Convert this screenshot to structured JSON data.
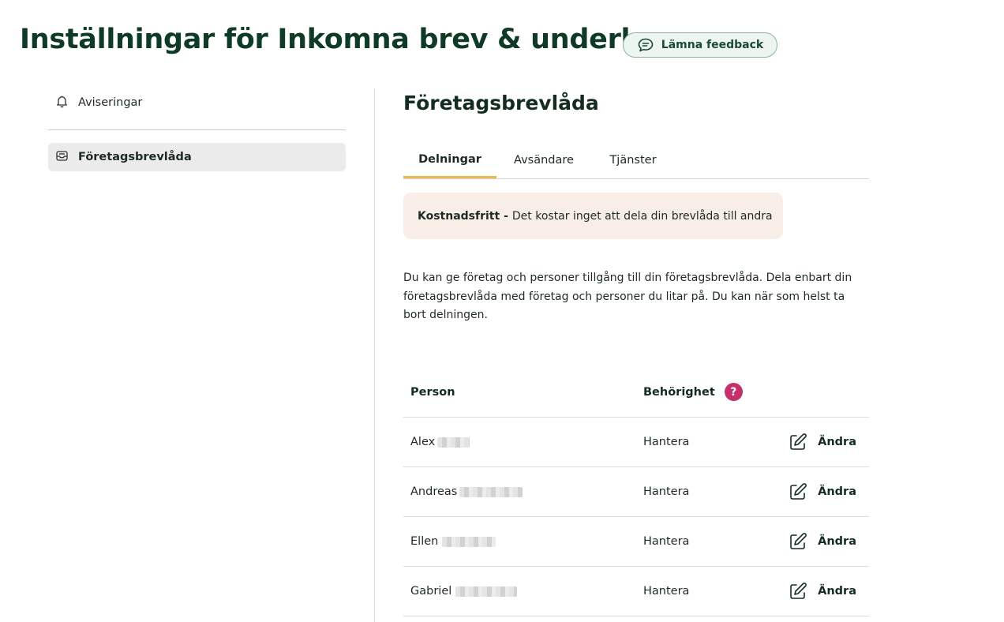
{
  "header": {
    "title": "Inställningar för Inkomna brev & underlag",
    "feedback_label": "Lämna feedback"
  },
  "sidebar": {
    "items": [
      {
        "label": "Aviseringar",
        "icon": "bell-icon"
      },
      {
        "label": "Företagsbrevlåda",
        "icon": "inbox-icon",
        "active": true
      }
    ]
  },
  "main": {
    "title": "Företagsbrevlåda",
    "tabs": [
      {
        "label": "Delningar",
        "active": true
      },
      {
        "label": "Avsändare"
      },
      {
        "label": "Tjänster"
      }
    ],
    "info": {
      "bold": "Kostnadsfritt -",
      "text": "Det kostar inget att dela din brevlåda till andra"
    },
    "description": "Du kan ge företag och personer tillgång till din företagsbrevlåda. Dela enbart din företagsbrevlåda med företag och personer du litar på. Du kan när som helst ta bort delningen.",
    "table": {
      "columns": {
        "person": "Person",
        "permission": "Behörighet",
        "help": "?"
      },
      "rows": [
        {
          "name": "Alex",
          "permission": "Hantera",
          "action": "Ändra"
        },
        {
          "name": "Andreas",
          "permission": "Hantera",
          "action": "Ändra"
        },
        {
          "name": "Ellen",
          "permission": "Hantera",
          "action": "Ändra"
        },
        {
          "name": "Gabriel",
          "permission": "Hantera",
          "action": "Ändra"
        }
      ]
    }
  },
  "colors": {
    "title": "#0f3a25",
    "tab_indicator": "#e8b94a",
    "info_bg": "#f8ede7",
    "help_icon": "#c52f6a",
    "feedback_bg": "#ecf5ef"
  }
}
